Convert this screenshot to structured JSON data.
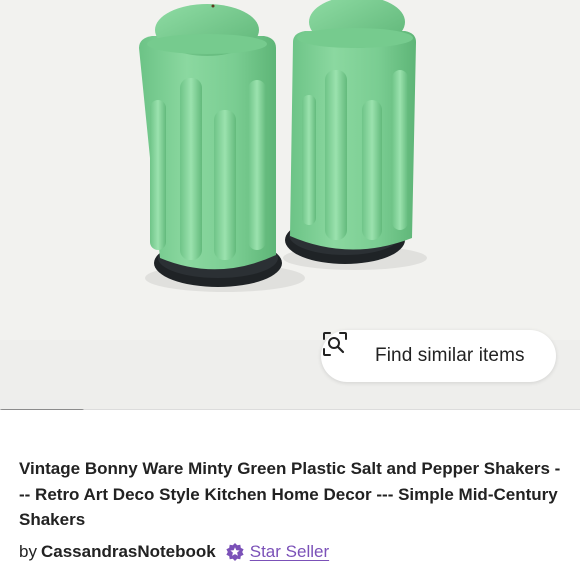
{
  "listing_image": {
    "alt": "Vintage green plastic salt and pepper shakers"
  },
  "find_similar": {
    "label": "Find similar items",
    "icon": "visual-search-icon"
  },
  "carousel": {
    "progress": 0.145
  },
  "listing": {
    "title": "Vintage Bonny Ware Minty Green Plastic Salt and Pepper Shakers --- Retro Art Deco Style Kitchen Home Decor --- Simple Mid-Century Shakers",
    "by_label": "by",
    "shop_name": "CassandrasNotebook",
    "badge_icon": "star-seller-badge-icon",
    "badge_label": "Star Seller"
  },
  "colors": {
    "shaker_green": "#7fcf95",
    "shaker_base": "#1f2326",
    "star_seller_purple": "#7b51b8",
    "background": "#f1f1ee"
  }
}
